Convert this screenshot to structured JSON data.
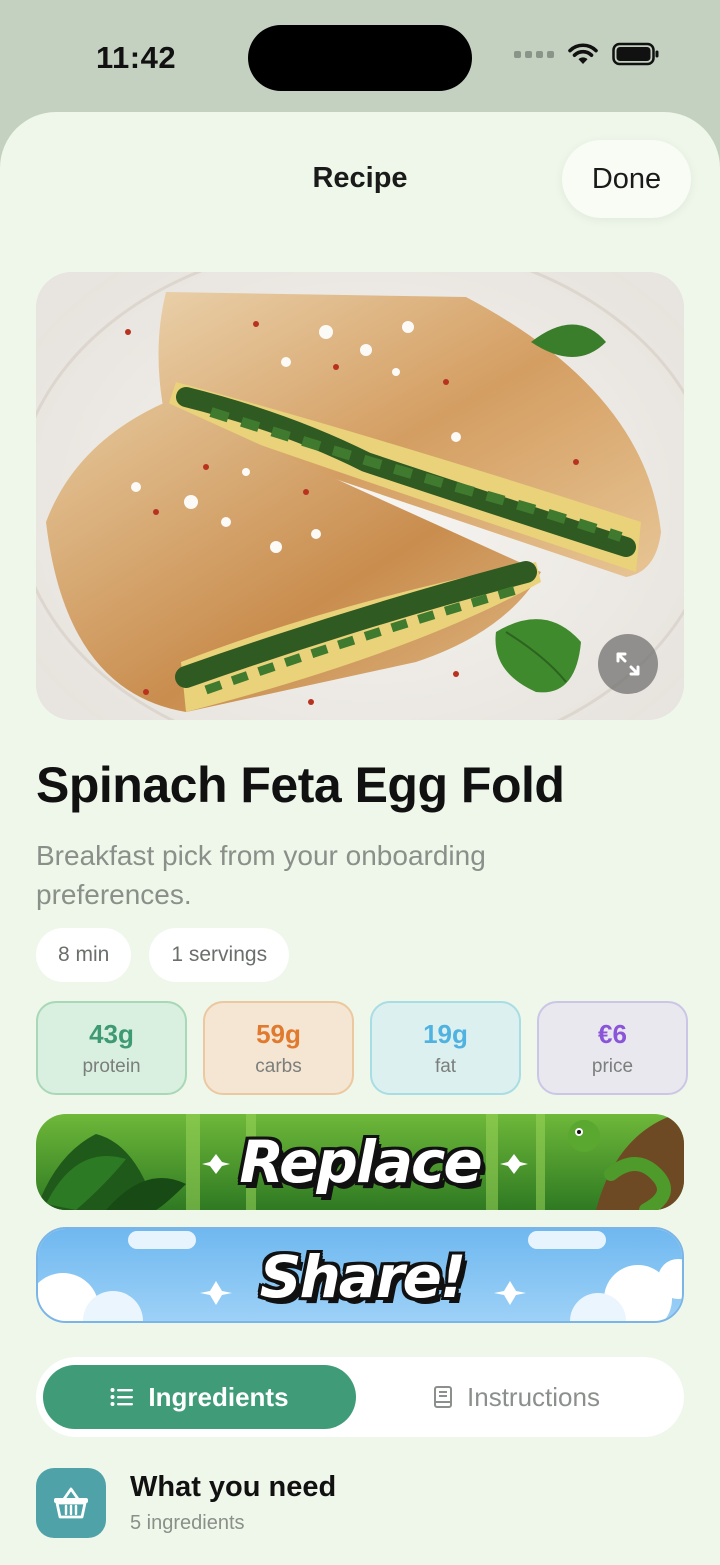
{
  "status_bar": {
    "time": "11:42"
  },
  "nav": {
    "title": "Recipe",
    "done_label": "Done"
  },
  "hero": {
    "alt_icon": "expand-icon"
  },
  "recipe": {
    "title": "Spinach Feta Egg Fold",
    "subtitle": "Breakfast pick from your onboarding preferences.",
    "pills": [
      "8 min",
      "1 servings"
    ]
  },
  "macros": [
    {
      "value": "43g",
      "label": "protein",
      "color": "#3d9a72",
      "bg": "#d9efdf",
      "border": "#a8d8b8"
    },
    {
      "value": "59g",
      "label": "carbs",
      "color": "#e07a2e",
      "bg": "#f4e6d2",
      "border": "#ecc8a0"
    },
    {
      "value": "19g",
      "label": "fat",
      "color": "#4fb2e0",
      "bg": "#dcf0f0",
      "border": "#a8dde4"
    },
    {
      "value": "€6",
      "label": "price",
      "color": "#8a55d8",
      "bg": "#e8e8ee",
      "border": "#cbc6e6"
    }
  ],
  "actions": {
    "replace_label": "Replace",
    "share_label": "Share!"
  },
  "tabs": [
    {
      "label": "Ingredients",
      "icon": "list-icon",
      "active": true
    },
    {
      "label": "Instructions",
      "icon": "book-icon",
      "active": false
    }
  ],
  "section": {
    "title": "What you need",
    "count": "5 ingredients",
    "icon": "basket-icon"
  },
  "colors": {
    "accent": "#3f9b78",
    "background": "#eef7e9"
  }
}
